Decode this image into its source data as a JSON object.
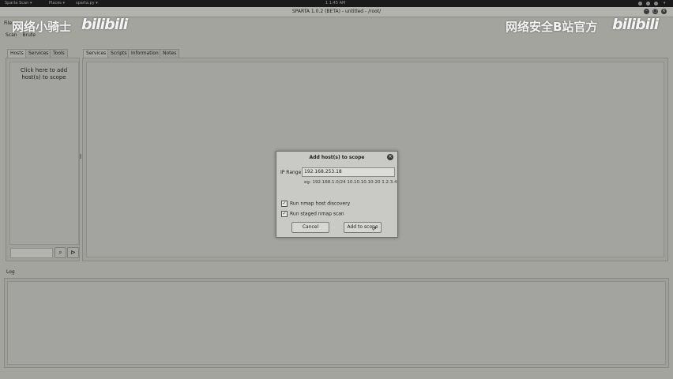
{
  "topbar": {
    "items": [
      "Sparta Scan ▾",
      "Places ▾",
      "sparta.py ▾"
    ],
    "clock": "1 1:45 AM"
  },
  "window": {
    "title": "SPARTA 1.0.2 (BETA) - untitled - /root/"
  },
  "menubar": {
    "file": "File",
    "scan": "Scan",
    "brute": "Brute"
  },
  "watermarks": {
    "left_text": "网络小骑士",
    "right_text": "网络安全B站官方",
    "logo": "bilibili"
  },
  "left_tabs": [
    "Hosts",
    "Services",
    "Tools"
  ],
  "left_panel": {
    "add_hosts_text": "Click here to add host(s) to scope"
  },
  "main_tabs": [
    "Services",
    "Scripts",
    "Information",
    "Notes"
  ],
  "log": {
    "tab": "Log"
  },
  "dialog": {
    "title": "Add host(s) to scope",
    "ip_label": "IP Range",
    "ip_value": "192.168.253.18",
    "example": "eg: 192.168.1.0/24 10.10.10.10-20 1.2.3.4",
    "options": [
      {
        "label": "Run nmap host discovery",
        "checked": true
      },
      {
        "label": "Run staged nmap scan",
        "checked": true
      }
    ],
    "cancel_label": "Cancel",
    "add_label": "Add to scope"
  }
}
